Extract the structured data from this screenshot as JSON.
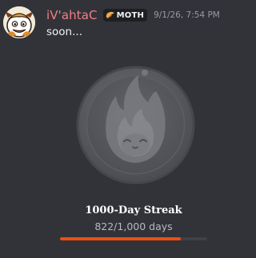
{
  "message": {
    "username": "iV'ahtaC",
    "tag": {
      "label": "MOTH",
      "icon": "moth-wing-icon"
    },
    "timestamp": "9/1/26, 7:54 PM",
    "text": "soon...",
    "avatar_icon": "avatar-character"
  },
  "badge": {
    "icon": "flame-medal-icon",
    "title": "1000-Day Streak",
    "progress_text": "822/1,000 days",
    "progress": 0.822,
    "progress_color": "#ed4e12"
  },
  "colors": {
    "username": "#f27f80",
    "background": "#323339"
  }
}
